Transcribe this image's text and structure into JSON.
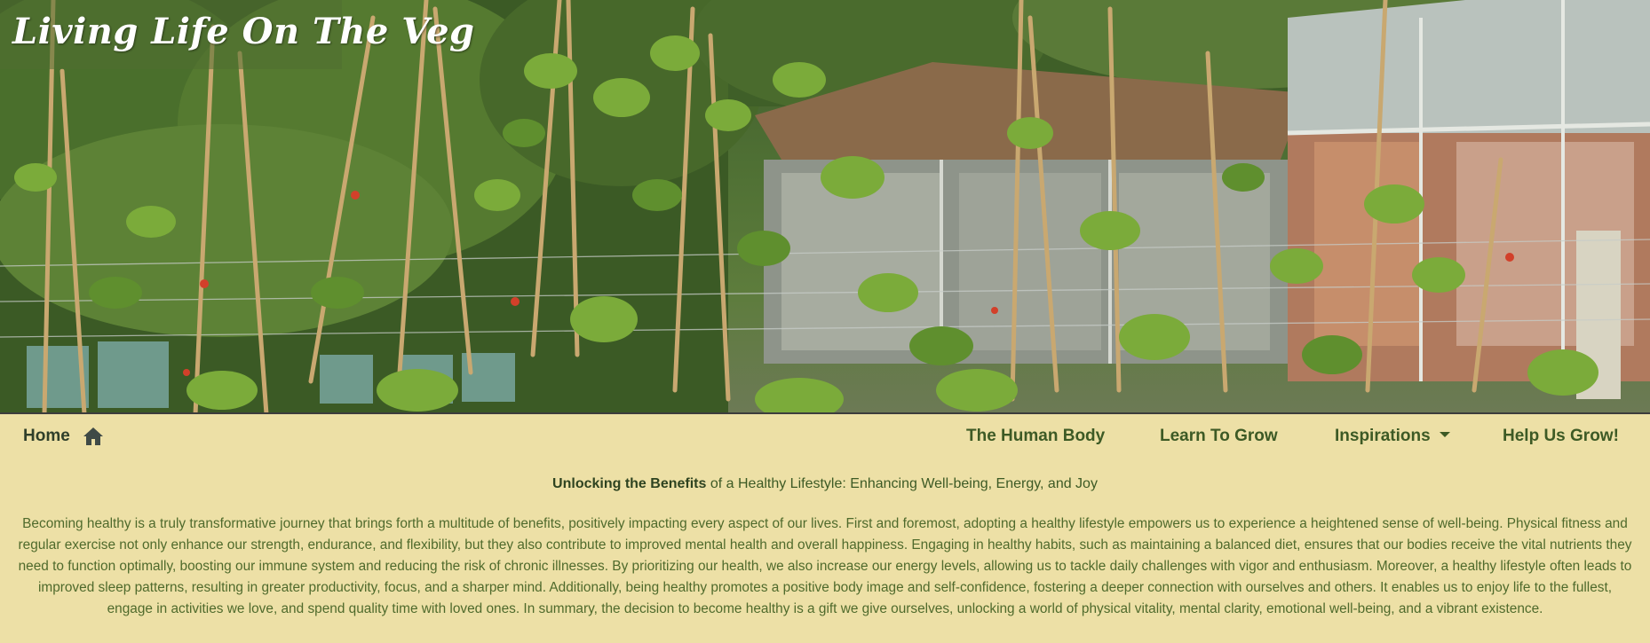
{
  "site": {
    "title": "Living Life On The Veg"
  },
  "nav": {
    "home_label": "Home",
    "items": [
      {
        "label": "The Human Body"
      },
      {
        "label": "Learn To Grow"
      },
      {
        "label": "Inspirations",
        "has_dropdown": true
      },
      {
        "label": "Help Us Grow!"
      }
    ]
  },
  "intro": {
    "bold": "Unlocking the Benefits",
    "rest": " of a Healthy Lifestyle: Enhancing Well-being, Energy, and Joy"
  },
  "body": {
    "paragraph": "Becoming healthy is a truly transformative journey that brings forth a multitude of benefits, positively impacting every aspect of our lives. First and foremost, adopting a healthy lifestyle empowers us to experience a heightened sense of well-being. Physical fitness and regular exercise not only enhance our strength, endurance, and flexibility, but they also contribute to improved mental health and overall happiness. Engaging in healthy habits, such as maintaining a balanced diet, ensures that our bodies receive the vital nutrients they need to function optimally, boosting our immune system and reducing the risk of chronic illnesses. By prioritizing our health, we also increase our energy levels, allowing us to tackle daily challenges with vigor and enthusiasm. Moreover, a healthy lifestyle often leads to improved sleep patterns, resulting in greater productivity, focus, and a sharper mind. Additionally, being healthy promotes a positive body image and self-confidence, fostering a deeper connection with ourselves and others. It enables us to enjoy life to the fullest, engage in activities we love, and spend quality time with loved ones. In summary, the decision to become healthy is a gift we give ourselves, unlocking a world of physical vitality, mental clarity, emotional well-being, and a vibrant existence."
  },
  "colors": {
    "page_background": "#ede0a6",
    "nav_text": "#3d5a25",
    "body_text": "#4f6a2c"
  },
  "icons": {
    "home": "home-icon",
    "dropdown": "caret-down-icon"
  }
}
